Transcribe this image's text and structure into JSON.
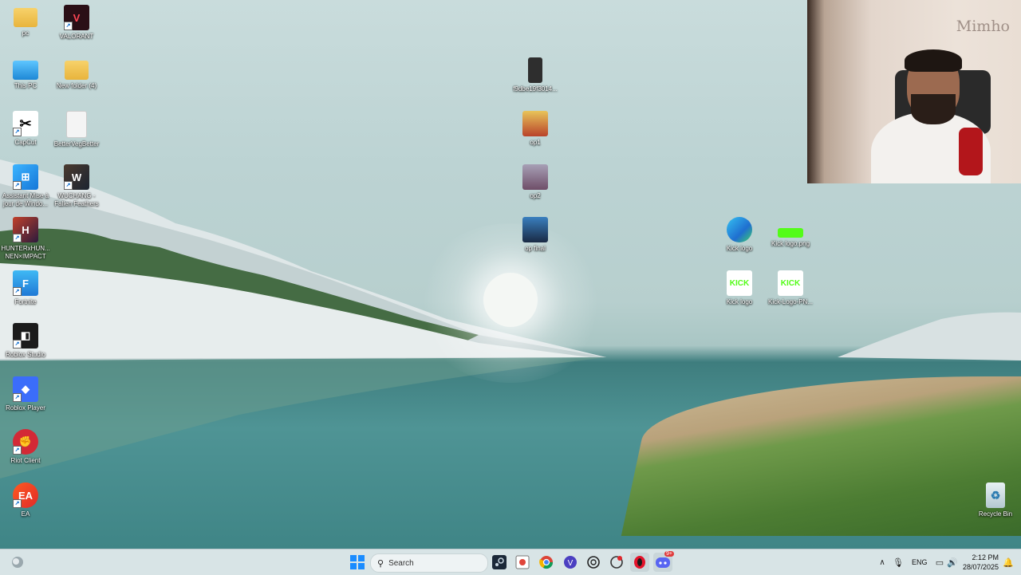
{
  "webcam": {
    "name": "Mimho"
  },
  "desktop_icons": {
    "pc": "pc",
    "valorant": "VALORANT",
    "this_pc": "This PC",
    "new_folder": "New folder (4)",
    "capcut": "CapCut",
    "bettervoid": "BetterVegBetter",
    "assistant": "Assistant Mise à jour de Windo...",
    "wuchang": "WUCHANG - Fallen Feathers",
    "hunterxhunter": "HUNTERxHUN... NEN×IMPACT",
    "fortnite": "Fortnite",
    "roblox_studio": "Roblox Studio",
    "roblox_player": "Roblox Player",
    "riot": "Riot Client",
    "ea": "EA",
    "img_file": "f9dbe19f3014...",
    "op1": "op1",
    "op2": "op2",
    "op_final": "op final",
    "kick_logo_edge": "Kick logo",
    "kick_logo_jpg": "Kick logo.png",
    "kick_logo_2": "Kick logo",
    "kick_logo_png": "Kick-Logo-PN...",
    "recycle_bin": "Recycle Bin"
  },
  "taskbar": {
    "search_placeholder": "Search",
    "language": "ENG",
    "time": "2:12 PM",
    "date": "28/07/2025",
    "discord_badge": "9+"
  },
  "colors": {
    "kick_green": "#53fc18",
    "taskbar_bg": "#d8e4e6",
    "accent": "#0078d4"
  }
}
